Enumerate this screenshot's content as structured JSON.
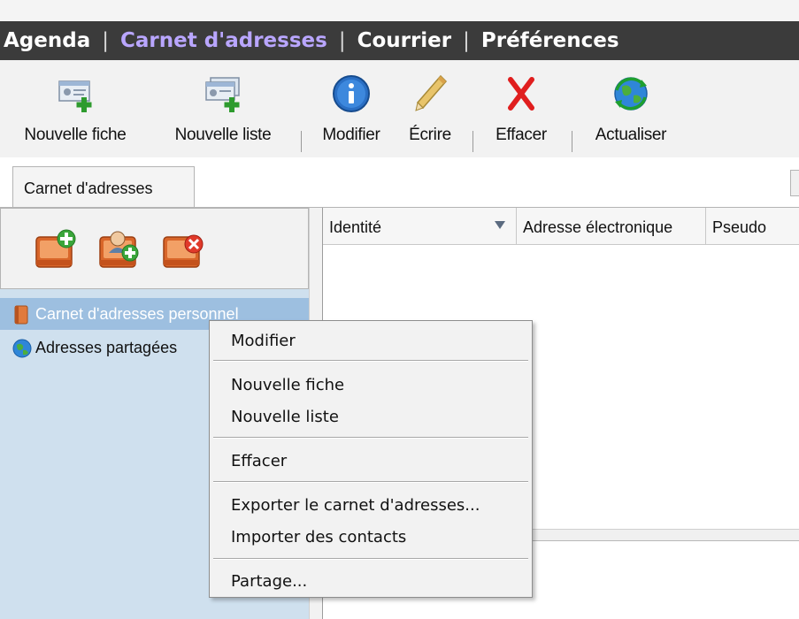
{
  "nav": {
    "items": [
      {
        "label": "Agenda",
        "active": false
      },
      {
        "label": "Carnet d'adresses",
        "active": true
      },
      {
        "label": "Courrier",
        "active": false
      },
      {
        "label": "Préférences",
        "active": false
      }
    ],
    "separator": "|",
    "active_color": "#b9a6ff"
  },
  "toolbar": {
    "new_card": "Nouvelle fiche",
    "new_list": "Nouvelle liste",
    "edit": "Modifier",
    "write": "Écrire",
    "delete": "Effacer",
    "refresh": "Actualiser",
    "icons": [
      "new-card-icon",
      "new-list-icon",
      "info-icon",
      "pencil-icon",
      "red-x-icon",
      "globe-refresh-icon"
    ]
  },
  "tab": {
    "label": "Carnet d'adresses"
  },
  "sidebar": {
    "items": [
      {
        "label": "Carnet d'adresses personnel",
        "selected": true,
        "icon": "address-book-icon"
      },
      {
        "label": "Adresses partagées",
        "selected": false,
        "icon": "globe-icon"
      }
    ],
    "buttons": [
      "add-addressbook-icon",
      "subscribe-addressbook-icon",
      "remove-addressbook-icon"
    ]
  },
  "list": {
    "columns": [
      "Identité",
      "Adresse électronique",
      "Pseudo"
    ],
    "sorted_column": "Identité"
  },
  "context_menu": {
    "edit": "Modifier",
    "new_card": "Nouvelle fiche",
    "new_list": "Nouvelle liste",
    "delete": "Effacer",
    "export": "Exporter le carnet d'adresses...",
    "import": "Importer des contacts",
    "share": "Partage..."
  }
}
